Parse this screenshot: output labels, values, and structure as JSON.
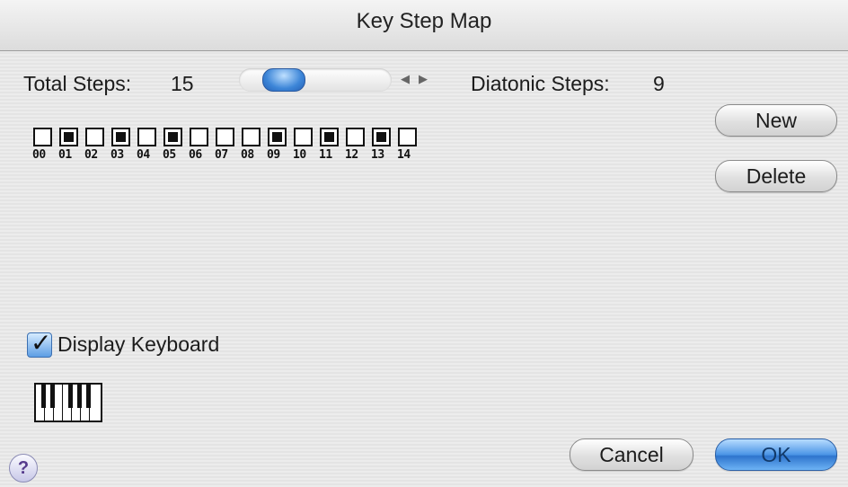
{
  "window": {
    "title": "Key Step Map"
  },
  "total_steps": {
    "label": "Total Steps:",
    "value": "15"
  },
  "diatonic_steps": {
    "label": "Diatonic Steps:",
    "value": "9"
  },
  "scrollbar": {
    "left_arrow_icon": "triangle-left-icon",
    "right_arrow_icon": "triangle-right-icon"
  },
  "steps": [
    {
      "num": "00",
      "black": false
    },
    {
      "num": "01",
      "black": true
    },
    {
      "num": "02",
      "black": false
    },
    {
      "num": "03",
      "black": true
    },
    {
      "num": "04",
      "black": false
    },
    {
      "num": "05",
      "black": true
    },
    {
      "num": "06",
      "black": false
    },
    {
      "num": "07",
      "black": false
    },
    {
      "num": "08",
      "black": false
    },
    {
      "num": "09",
      "black": true
    },
    {
      "num": "10",
      "black": false
    },
    {
      "num": "11",
      "black": true
    },
    {
      "num": "12",
      "black": false
    },
    {
      "num": "13",
      "black": true
    },
    {
      "num": "14",
      "black": false
    }
  ],
  "buttons": {
    "new": "New",
    "delete": "Delete",
    "cancel": "Cancel",
    "ok": "OK",
    "help": "?"
  },
  "display_keyboard": {
    "label": "Display Keyboard",
    "checked": true
  },
  "colors": {
    "accent": "#3d86d8"
  }
}
